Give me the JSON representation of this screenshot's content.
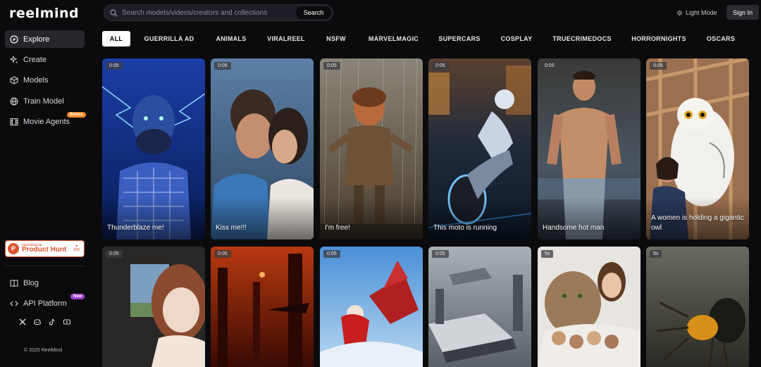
{
  "app": {
    "logo": "reelmind"
  },
  "sidebar": {
    "items": [
      {
        "label": "Explore",
        "icon": "compass-icon"
      },
      {
        "label": "Create",
        "icon": "sparkle-icon"
      },
      {
        "label": "Models",
        "icon": "cube-icon"
      },
      {
        "label": "Train Model",
        "icon": "globe-icon"
      },
      {
        "label": "Movie Agents",
        "icon": "film-icon",
        "badge": "Bonus"
      }
    ],
    "product_hunt": {
      "featured": "FEATURED ON",
      "name": "Product Hunt",
      "count": "658"
    },
    "links": [
      {
        "label": "Blog",
        "icon": "book-icon"
      },
      {
        "label": "API Platform",
        "icon": "code-icon",
        "badge": "New"
      }
    ],
    "socials": [
      "x-icon",
      "discord-icon",
      "tiktok-icon",
      "youtube-icon"
    ],
    "copyright": "© 2025 ReelMind"
  },
  "header": {
    "search_placeholder": "Search models/videos/creators and collections",
    "search_button": "Search",
    "light_mode": "Light Mode",
    "sign_in": "Sign In"
  },
  "tabs": [
    "ALL",
    "GUERRILLA AD",
    "ANIMALS",
    "VIRALREEL",
    "NSFW",
    "MARVELMAGIC",
    "SUPERCARS",
    "COSPLAY",
    "TRUECRIMEDOCS",
    "HORRORNIGHTS",
    "OSCARS"
  ],
  "cards_row1": [
    {
      "duration": "0:05",
      "caption": "Thunderblaze me!"
    },
    {
      "duration": "0:05",
      "caption": "Kiss me!!!"
    },
    {
      "duration": "0:05",
      "caption": "I'm free!"
    },
    {
      "duration": "0:05",
      "caption": "This moto is running"
    },
    {
      "duration": "0:05",
      "caption": "Handsome hot man"
    },
    {
      "duration": "0:05",
      "caption": "A women is holding a gigantic owl"
    }
  ],
  "cards_row2": [
    {
      "duration": "0:05"
    },
    {
      "duration": "0:05"
    },
    {
      "duration": "0:05"
    },
    {
      "duration": "0:05"
    },
    {
      "duration": "5s"
    },
    {
      "duration": "5s"
    }
  ],
  "colors": {
    "accent": "#ffffff",
    "bonus": "#f08a24",
    "new": "#a33fd1",
    "product_hunt": "#da552f"
  }
}
